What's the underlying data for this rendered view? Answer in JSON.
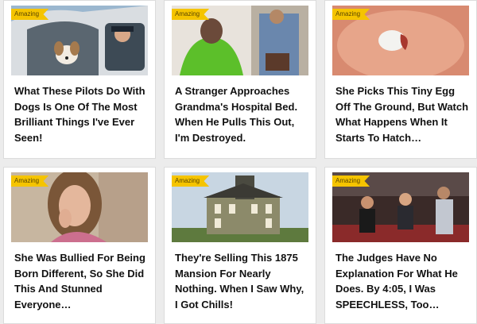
{
  "badge_label": "Amazing",
  "colors": {
    "badge": "#f5c400",
    "background": "#ececec",
    "card": "#ffffff",
    "title": "#111111"
  },
  "cards": [
    {
      "badge": "Amazing",
      "title": "What These Pilots Do With Dogs Is One Of The Most Brilliant Things I've Ever Seen!"
    },
    {
      "badge": "Amazing",
      "title": "A Stranger Approaches Grandma's Hospital Bed. When He Pulls This Out, I'm Destroyed."
    },
    {
      "badge": "Amazing",
      "title": "She Picks This Tiny Egg Off The Ground, But Watch What Happens When It Starts To Hatch…"
    },
    {
      "badge": "Amazing",
      "title": "She Was Bullied For Being Born Different, So She Did This And Stunned Everyone…"
    },
    {
      "badge": "Amazing",
      "title": "They're Selling This 1875 Mansion For Nearly Nothing. When I Saw Why, I Got Chills!"
    },
    {
      "badge": "Amazing",
      "title": "The Judges Have No Explanation For What He Does. By 4:05, I Was SPEECHLESS, Too…"
    }
  ]
}
